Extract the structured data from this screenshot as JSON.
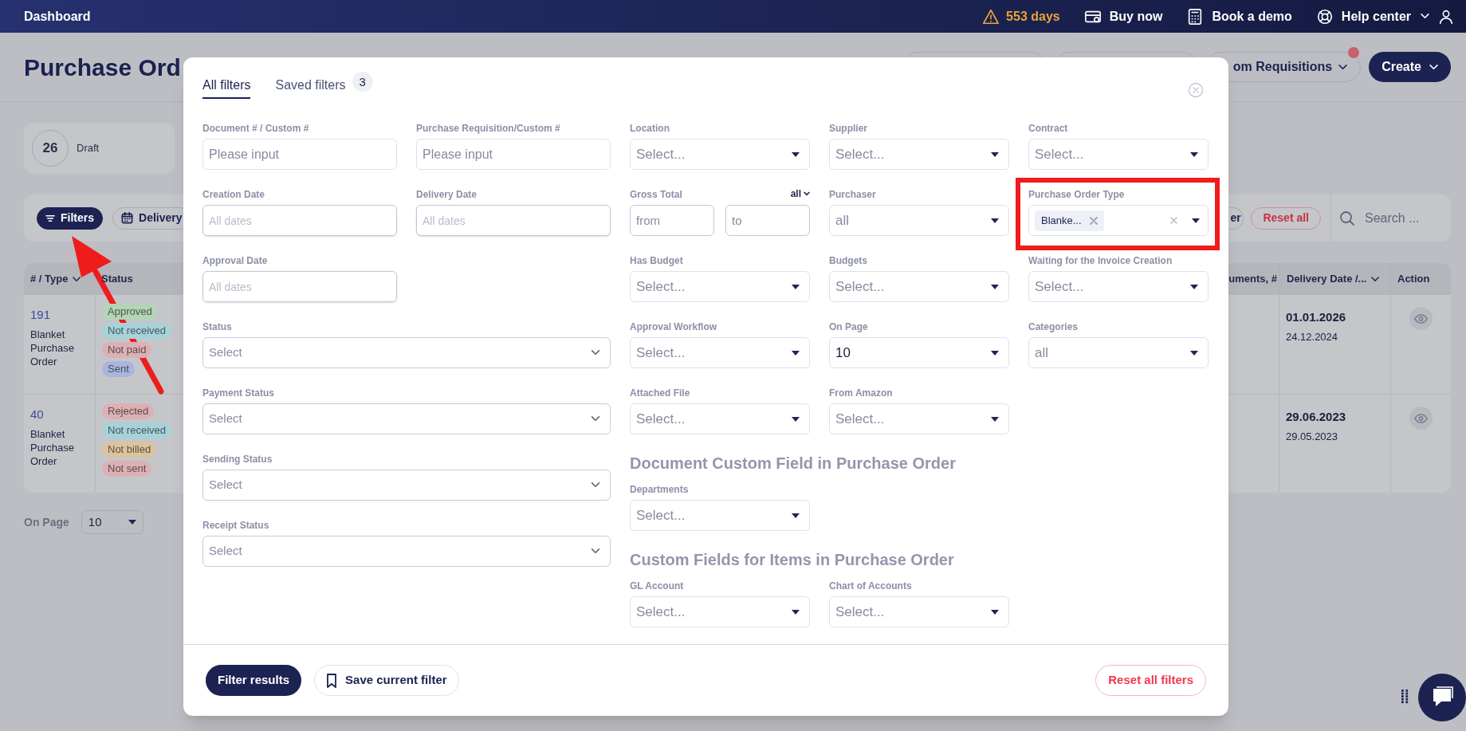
{
  "topbar": {
    "title": "Dashboard",
    "trial": "553 days",
    "links": [
      {
        "kind": "card",
        "label": "Buy now"
      },
      {
        "kind": "calculator",
        "label": "Book a demo"
      },
      {
        "kind": "lifebuoy",
        "label": "Help center"
      }
    ]
  },
  "page": {
    "title": "Purchase Ord",
    "header_buttons": [
      {
        "kind": "blank"
      },
      {
        "kind": "blank"
      },
      {
        "kind": "outline",
        "label": "om Requisitions",
        "notification": true
      },
      {
        "kind": "primary",
        "label": "Create"
      }
    ],
    "summary": {
      "count": "26",
      "label": "Draft"
    },
    "toolbar": {
      "buttons": [
        {
          "kind": "filters",
          "label": "Filters",
          "active": true
        },
        {
          "kind": "calendar",
          "label": "Delivery",
          "active": false
        }
      ],
      "right_button": "er",
      "reset": "Reset all",
      "search_placeholder": "Search ..."
    },
    "table": {
      "columns": [
        {
          "label": "# / Type",
          "sortable": true
        },
        {
          "label": "Status",
          "sortable": false
        },
        {
          "label": "uments, #",
          "sortable": false
        },
        {
          "label": "Delivery Date /...",
          "sortable": true
        },
        {
          "label": "Action",
          "sortable": false
        }
      ],
      "rows": [
        {
          "number": "191",
          "type": "Blanket Purchase Order",
          "statuses": [
            {
              "label": "Approved",
              "color": "#b3d4b6"
            },
            {
              "label": "Not received",
              "color": "#a6d2d9"
            },
            {
              "label": "Not paid",
              "color": "#dcb1b6"
            },
            {
              "label": "Sent",
              "color": "#aab5dd"
            }
          ],
          "delivery_date": "01.01.2026",
          "second_date": "24.12.2024"
        },
        {
          "number": "40",
          "type": "Blanket Purchase Order",
          "statuses": [
            {
              "label": "Rejected",
              "color": "#dcb1b6"
            },
            {
              "label": "Not received",
              "color": "#a6d2d9"
            },
            {
              "label": "Not billed",
              "color": "#dcc39f"
            },
            {
              "label": "Not sent",
              "color": "#dcb1b6"
            }
          ],
          "delivery_date": "29.06.2023",
          "second_date": "29.05.2023"
        }
      ]
    },
    "pagination": {
      "label": "On Page",
      "value": "10"
    }
  },
  "modal": {
    "tabs": [
      {
        "label": "All filters",
        "selected": true
      },
      {
        "label": "Saved filters",
        "count": "3",
        "selected": false
      }
    ],
    "left_filters": [
      {
        "kind": "text",
        "label": "Document # / Custom #",
        "placeholder": "Please input"
      },
      {
        "kind": "text",
        "label": "Purchase Requisition/Custom #",
        "placeholder": "Please input"
      },
      {
        "kind": "date",
        "label": "Creation Date",
        "placeholder": "All dates"
      },
      {
        "kind": "date",
        "label": "Delivery Date",
        "placeholder": "All dates"
      },
      {
        "kind": "date",
        "label": "Approval Date",
        "placeholder": "All dates"
      },
      {
        "kind": "wide_select",
        "label": "Status",
        "placeholder": "Select"
      },
      {
        "kind": "wide_select",
        "label": "Payment Status",
        "placeholder": "Select"
      },
      {
        "kind": "wide_select",
        "label": "Sending Status",
        "placeholder": "Select"
      },
      {
        "kind": "wide_select",
        "label": "Receipt Status",
        "placeholder": "Select"
      }
    ],
    "right_filters": [
      {
        "kind": "dropdown",
        "label": "Location",
        "placeholder": "Select..."
      },
      {
        "kind": "dropdown",
        "label": "Supplier",
        "placeholder": "Select..."
      },
      {
        "kind": "dropdown",
        "label": "Contract",
        "placeholder": "Select..."
      },
      {
        "kind": "range",
        "label": "Gross Total",
        "mode": "all",
        "from_placeholder": "from",
        "to_placeholder": "to"
      },
      {
        "kind": "dropdown",
        "label": "Purchaser",
        "placeholder": "all"
      },
      {
        "kind": "tags",
        "label": "Purchase Order Type",
        "tags": [
          "Blanke..."
        ],
        "highlighted": true
      },
      {
        "kind": "dropdown",
        "label": "Has Budget",
        "placeholder": "Select..."
      },
      {
        "kind": "dropdown",
        "label": "Budgets",
        "placeholder": "Select..."
      },
      {
        "kind": "dropdown",
        "label": "Waiting for the Invoice Creation",
        "placeholder": "Select..."
      },
      {
        "kind": "dropdown",
        "label": "Approval Workflow",
        "placeholder": "Select..."
      },
      {
        "kind": "dropdown",
        "label": "On Page",
        "value": "10"
      },
      {
        "kind": "dropdown",
        "label": "Categories",
        "placeholder": "all"
      },
      {
        "kind": "dropdown",
        "label": "Attached File",
        "placeholder": "Select..."
      },
      {
        "kind": "dropdown",
        "label": "From Amazon",
        "placeholder": "Select..."
      },
      {
        "kind": "heading",
        "label": "Document Custom Field in Purchase Order"
      },
      {
        "kind": "dropdown",
        "label": "Departments",
        "placeholder": "Select..."
      },
      {
        "kind": "heading",
        "label": "Custom Fields for Items in Purchase Order"
      },
      {
        "kind": "dropdown",
        "label": "GL Account",
        "placeholder": "Select..."
      },
      {
        "kind": "dropdown",
        "label": "Chart of Accounts",
        "placeholder": "Select..."
      }
    ],
    "footer": {
      "primary": "Filter results",
      "save": "Save current filter",
      "reset": "Reset all filters"
    }
  }
}
